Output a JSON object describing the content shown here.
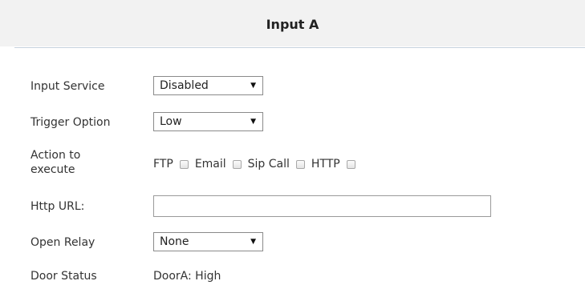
{
  "header": {
    "title": "Input A"
  },
  "form": {
    "input_service": {
      "label": "Input Service",
      "value": "Disabled"
    },
    "trigger_option": {
      "label": "Trigger Option",
      "value": "Low"
    },
    "action_to_execute": {
      "label_line1": "Action to",
      "label_line2": "execute",
      "options": [
        {
          "label": "FTP",
          "checked": false
        },
        {
          "label": "Email",
          "checked": false
        },
        {
          "label": "Sip Call",
          "checked": false
        },
        {
          "label": "HTTP",
          "checked": false
        }
      ]
    },
    "http_url": {
      "label": "Http URL:",
      "value": "",
      "placeholder": ""
    },
    "open_relay": {
      "label": "Open Relay",
      "value": "None"
    },
    "door_status": {
      "label": "Door Status",
      "value": "DoorA: High"
    }
  },
  "icons": {
    "dropdown_arrow": "chevron-down-icon",
    "arrow_glyph": "▼"
  }
}
